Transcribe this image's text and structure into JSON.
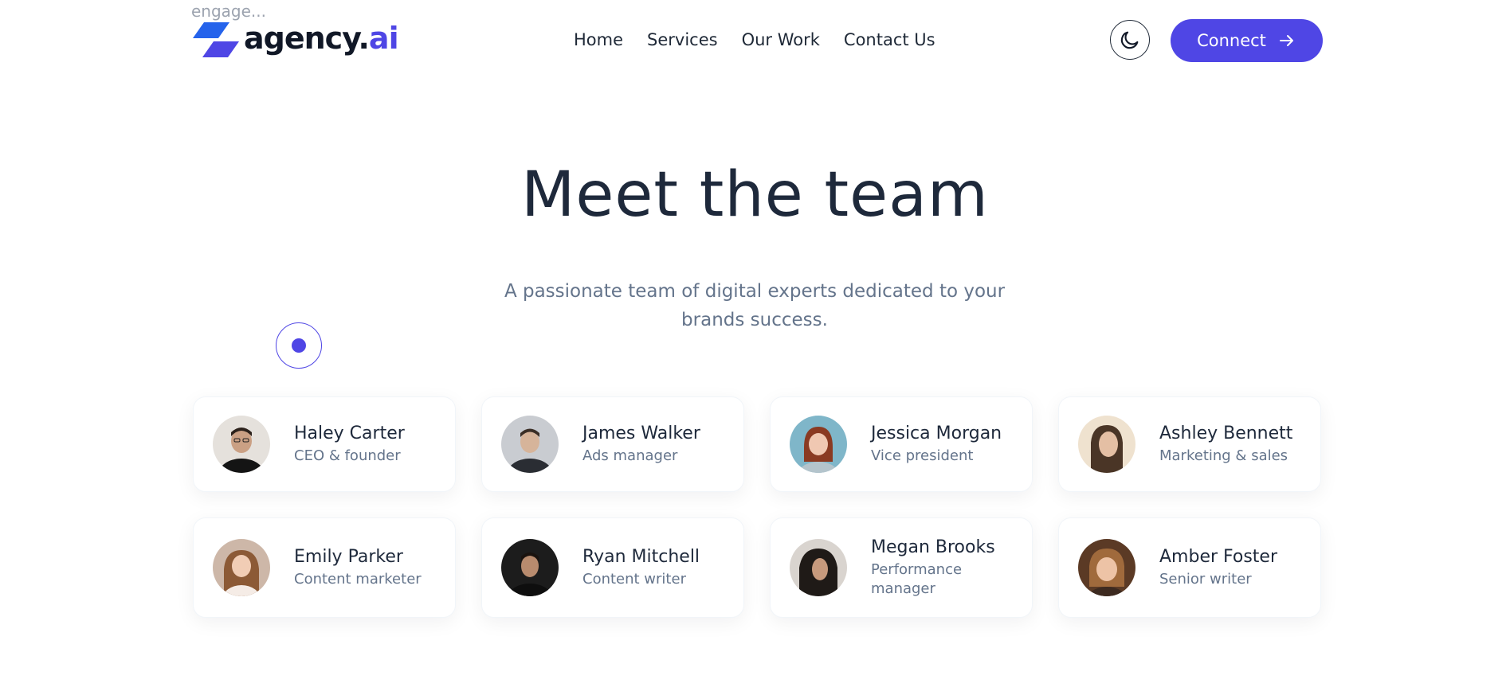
{
  "header": {
    "overlay_text": "engage...",
    "logo": {
      "text": "agency.",
      "accent": "ai"
    },
    "nav": [
      "Home",
      "Services",
      "Our Work",
      "Contact Us"
    ],
    "theme_toggle_icon": "moon-icon",
    "connect_button": {
      "label": "Connect",
      "icon": "arrow-right-icon"
    }
  },
  "hero": {
    "title": "Meet the team",
    "subtitle": "A passionate team of digital experts dedicated to your brands success."
  },
  "team": [
    {
      "name": "Haley Carter",
      "role": "CEO & founder"
    },
    {
      "name": "James Walker",
      "role": "Ads manager"
    },
    {
      "name": "Jessica Morgan",
      "role": "Vice president"
    },
    {
      "name": "Ashley Bennett",
      "role": "Marketing & sales"
    },
    {
      "name": "Emily Parker",
      "role": "Content marketer"
    },
    {
      "name": "Ryan Mitchell",
      "role": "Content writer"
    },
    {
      "name": "Megan Brooks",
      "role": "Performance manager"
    },
    {
      "name": "Amber Foster",
      "role": "Senior writer"
    }
  ],
  "colors": {
    "accent": "#4f46e5",
    "heading": "#1e293b",
    "muted": "#64748b"
  }
}
